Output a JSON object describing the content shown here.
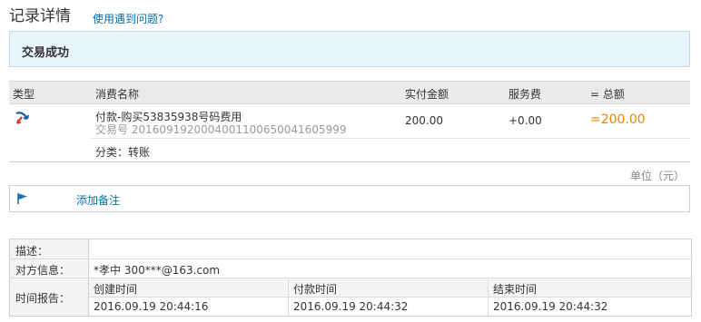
{
  "page_title": "记录详情",
  "help_link": "使用遇到问题?",
  "status": "交易成功",
  "table": {
    "headers": {
      "type": "类型",
      "name": "消费名称",
      "paid": "实付金额",
      "fee": "服务费",
      "total": "= 总额"
    },
    "row": {
      "name": "付款-购买53835938号码费用",
      "trade_no": "交易号 2016091920004001100650041605999",
      "paid": "200.00",
      "fee": "+0.00",
      "total": "=200.00",
      "category": "分类：转账"
    }
  },
  "unit": "单位（元）",
  "remark_link": "添加备注",
  "info": {
    "desc_label": "描述：",
    "desc_value": "",
    "counterparty_label": "对方信息：",
    "counterparty_value": "*孝中 300***@163.com",
    "time_label": "时间报告：",
    "times": [
      {
        "label": "创建时间",
        "value": "2016.09.19 20:44:16"
      },
      {
        "label": "付款时间",
        "value": "2016.09.19 20:44:32"
      },
      {
        "label": "结束时间",
        "value": "2016.09.19 20:44:32"
      }
    ]
  },
  "colors": {
    "accent_link": "#0b6ea8",
    "total_orange": "#f08300",
    "status_bg": "#e8f4fb"
  },
  "icons": {
    "type_icon": "transfer-arrow-icon",
    "remark_icon": "flag-icon"
  }
}
